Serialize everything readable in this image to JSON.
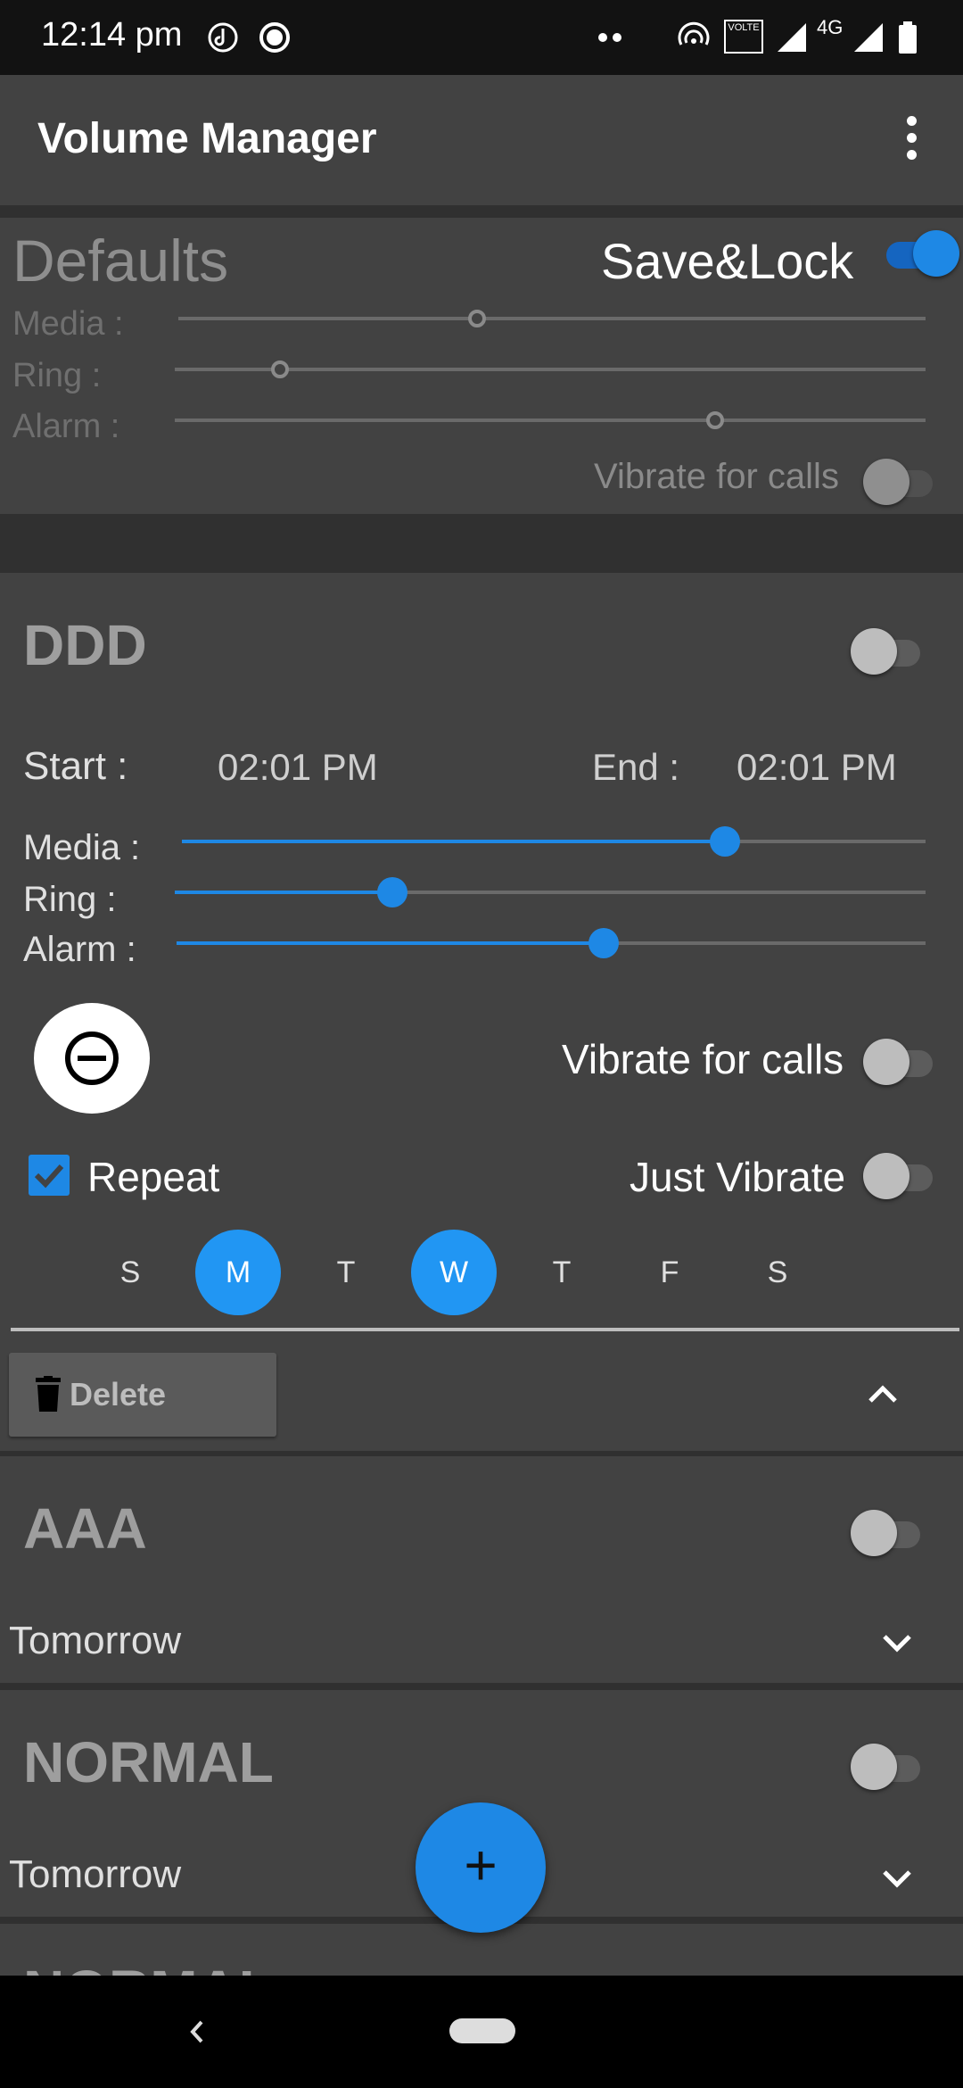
{
  "status": {
    "time": "12:14 pm",
    "network": "4G",
    "volte": "VOLTE"
  },
  "app": {
    "title": "Volume Manager"
  },
  "defaults": {
    "title": "Defaults",
    "save_lock_label": "Save&Lock",
    "save_lock_on": true,
    "media_label": "Media :",
    "ring_label": "Ring   :",
    "alarm_label": "Alarm :",
    "media_level": 0.4,
    "ring_level": 0.14,
    "alarm_level": 0.72,
    "vibrate_label": "Vibrate for calls",
    "vibrate_on": false
  },
  "profiles": [
    {
      "name": "DDD",
      "enabled": false,
      "start_label": "Start :",
      "start_time": "02:01 PM",
      "end_label": "End :",
      "end_time": "02:01 PM",
      "media_label": "Media :",
      "ring_label": "Ring :",
      "alarm_label": "Alarm :",
      "media_level": 0.73,
      "ring_level": 0.29,
      "alarm_level": 0.57,
      "vibrate_label": "Vibrate for calls",
      "vibrate_on": false,
      "repeat_label": "Repeat",
      "repeat_checked": true,
      "just_vibrate_label": "Just Vibrate",
      "just_vibrate_on": false,
      "days": [
        {
          "label": "S",
          "selected": false
        },
        {
          "label": "M",
          "selected": true
        },
        {
          "label": "T",
          "selected": false
        },
        {
          "label": "W",
          "selected": true
        },
        {
          "label": "T",
          "selected": false
        },
        {
          "label": "F",
          "selected": false
        },
        {
          "label": "S",
          "selected": false
        }
      ],
      "delete_label": "Delete"
    },
    {
      "name": "AAA",
      "enabled": false,
      "subtitle": "Tomorrow"
    },
    {
      "name": "NORMAL",
      "enabled": false,
      "subtitle": "Tomorrow"
    },
    {
      "name": "NORMAL"
    }
  ],
  "fab": {
    "icon": "+"
  },
  "colors": {
    "accent": "#1e88e5",
    "card": "#424242",
    "background": "#303030"
  }
}
